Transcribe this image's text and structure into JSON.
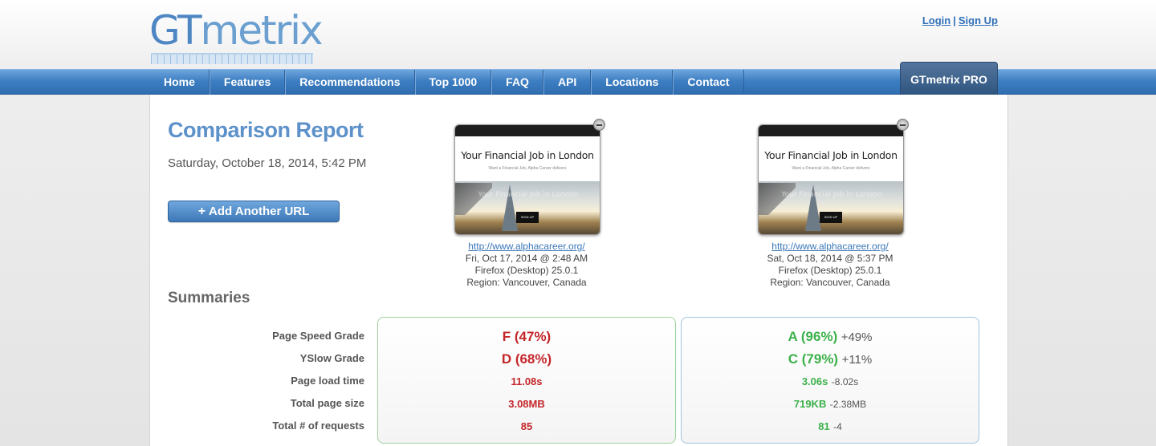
{
  "brand": {
    "logo_prefix": "GT",
    "logo_suffix": "metrix"
  },
  "auth": {
    "login": "Login",
    "separator": "|",
    "signup": "Sign Up"
  },
  "nav": {
    "items": [
      "Home",
      "Features",
      "Recommendations",
      "Top 1000",
      "FAQ",
      "API",
      "Locations",
      "Contact"
    ],
    "pro": "GTmetrix PRO"
  },
  "report": {
    "title": "Comparison Report",
    "date": "Saturday, October 18, 2014, 5:42 PM",
    "add_button": "Add Another URL"
  },
  "screenshots": [
    {
      "heading": "Your Financial Job in London",
      "subheading": "Want a Financial Job, Alpha Career delivers",
      "cta": "SIGN UP",
      "url": "http://www.alphacareer.org/",
      "tested": "Fri, Oct 17, 2014 @ 2:48 AM",
      "browser": "Firefox (Desktop) 25.0.1",
      "region": "Region: Vancouver, Canada"
    },
    {
      "heading": "Your Financial Job in London",
      "subheading": "Want a Financial Job, Alpha Career delivers",
      "cta": "SIGN UP",
      "url": "http://www.alphacareer.org/",
      "tested": "Sat, Oct 18, 2014 @ 5:37 PM",
      "browser": "Firefox (Desktop) 25.0.1",
      "region": "Region: Vancouver, Canada"
    }
  ],
  "summaries": {
    "title": "Summaries",
    "labels": [
      "Page Speed Grade",
      "YSlow Grade",
      "Page load time",
      "Total page size",
      "Total # of requests"
    ],
    "before": {
      "page_speed": "F (47%)",
      "yslow": "D (68%)",
      "load_time": "11.08s",
      "page_size": "3.08MB",
      "requests": "85"
    },
    "after": {
      "page_speed": "A (96%)",
      "page_speed_delta": "+49%",
      "yslow": "C (79%)",
      "yslow_delta": "+11%",
      "load_time": "3.06s",
      "load_time_delta": "-8.02s",
      "page_size": "719KB",
      "page_size_delta": "-2.38MB",
      "requests": "81",
      "requests_delta": "-4"
    }
  },
  "colors": {
    "accent": "#5d91c9",
    "bad": "#c4262a",
    "good": "#3bb14a",
    "nav": "#3e7fc3"
  }
}
